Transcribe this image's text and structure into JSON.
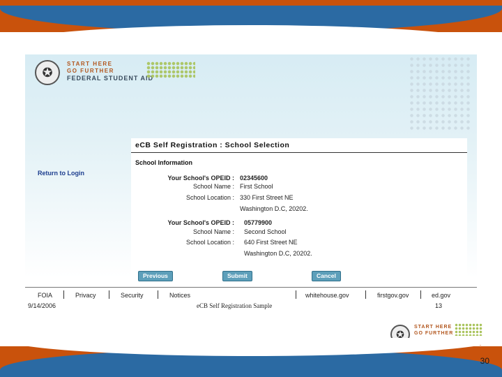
{
  "slide": {
    "page_number": "30"
  },
  "logo": {
    "line1": "START HERE",
    "line2": "GO FURTHER",
    "line3": "FEDERAL STUDENT AID"
  },
  "sidebar": {
    "return_link": "Return to Login"
  },
  "form": {
    "title": "eCB Self Registration : School Selection",
    "section": "School Information",
    "schools": [
      {
        "opeid_label": "Your School's OPEID :",
        "opeid": "02345600",
        "name_label": "School Name :",
        "name": "First School",
        "location_label": "School Location :",
        "address1": "330 First Street NE",
        "address2": "Washington D.C, 20202."
      },
      {
        "opeid_label": "Your School's OPEID :",
        "opeid": "05779900",
        "name_label": "School Name :",
        "name": "Second School",
        "location_label": "School Location :",
        "address1": "640 First Street NE",
        "address2": "Washington D.C, 20202."
      }
    ],
    "buttons": {
      "previous": "Previous",
      "submit": "Submit",
      "cancel": "Cancel"
    }
  },
  "footer": {
    "links": [
      "FOIA",
      "Privacy",
      "Security",
      "Notices",
      "whitehouse.gov",
      "firstgov.gov",
      "ed.gov"
    ],
    "date": "9/14/2006",
    "caption": "eCB Self Registration Sample",
    "page": "13"
  }
}
